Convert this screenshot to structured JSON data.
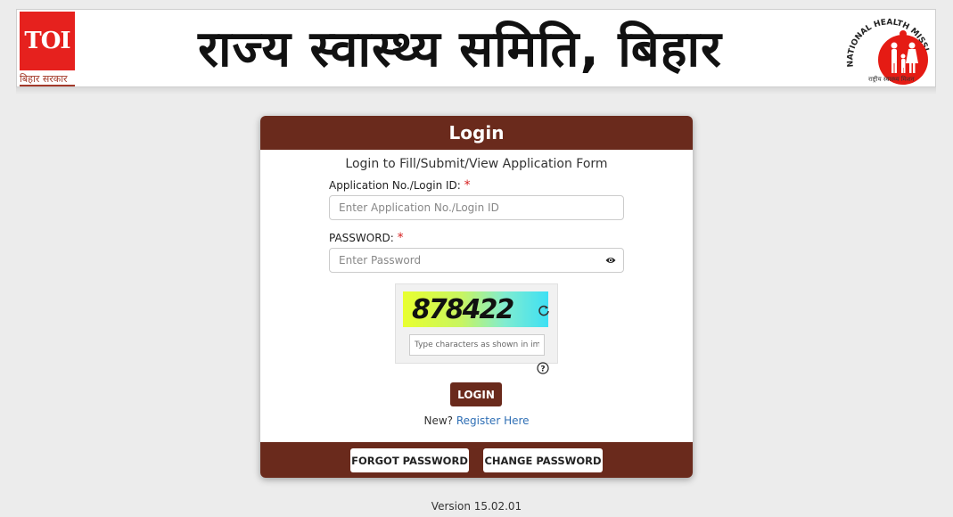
{
  "header": {
    "toi_logo": "TOI",
    "state_govt_label": "बिहार सरकार",
    "title": "राज्य स्वास्थ्य समिति, बिहार",
    "nhm_logo_text": "NATIONAL HEALTH MISSION",
    "nhm_caption": "राष्ट्रीय स्वास्थ्य मिशन"
  },
  "login_card": {
    "title": "Login",
    "subtitle": "Login to Fill/Submit/View Application Form",
    "login_id_label": "Application No./Login ID:",
    "login_id_placeholder": "Enter Application No./Login ID",
    "password_label": "PASSWORD:",
    "password_placeholder": "Enter Password",
    "required_marker": "*",
    "captcha_text": "878422",
    "captcha_placeholder": "Type characters as shown in image",
    "login_button": "LOGIN",
    "register_prompt": "New?",
    "register_link": "Register Here",
    "forgot_password_button": "FORGOT PASSWORD",
    "change_password_button": "CHANGE PASSWORD"
  },
  "footer": {
    "version": "Version 15.02.01"
  },
  "colors": {
    "brand_brown": "#6a2a1c",
    "toi_red": "#e6211e",
    "link_blue": "#2f6fb5",
    "required_red": "#d62020"
  },
  "icons": {
    "password_toggle": "eye-icon",
    "captcha_refresh": "refresh-icon",
    "captcha_help": "help-icon"
  }
}
